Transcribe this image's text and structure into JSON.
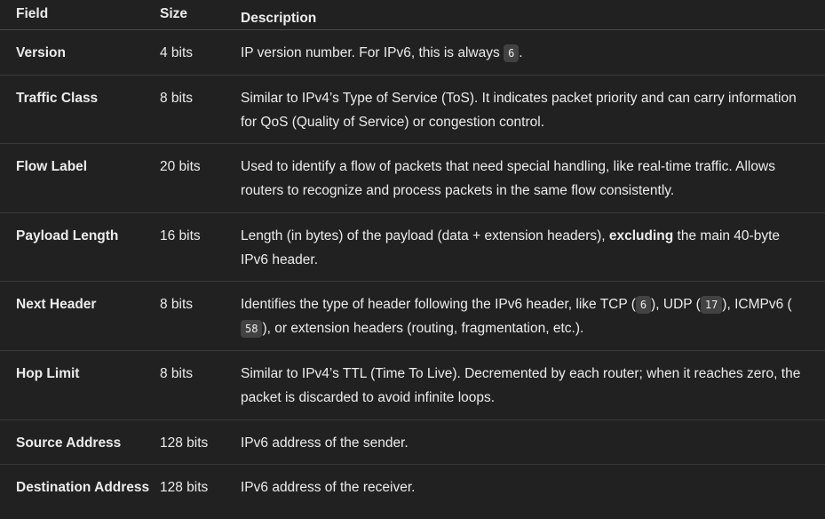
{
  "columns": [
    "Field",
    "Size",
    "Description"
  ],
  "rows": [
    {
      "field": "Version",
      "size": "4 bits",
      "desc": [
        {
          "t": "IP version number. For IPv6, this is always "
        },
        {
          "code": "6"
        },
        {
          "t": "."
        }
      ]
    },
    {
      "field": "Traffic Class",
      "size": "8 bits",
      "desc": [
        {
          "t": "Similar to IPv4’s Type of Service (ToS). It indicates packet priority and can carry information for QoS (Quality of Service) or congestion control."
        }
      ]
    },
    {
      "field": "Flow Label",
      "size": "20 bits",
      "desc": [
        {
          "t": "Used to identify a flow of packets that need special handling, like real-time traffic. Allows routers to recognize and process packets in the same flow consistently."
        }
      ]
    },
    {
      "field": "Payload Length",
      "size": "16 bits",
      "desc": [
        {
          "t": "Length (in bytes) of the payload (data + extension headers), "
        },
        {
          "b": "excluding"
        },
        {
          "t": " the main 40-byte IPv6 header."
        }
      ]
    },
    {
      "field": "Next Header",
      "size": "8 bits",
      "desc": [
        {
          "t": "Identifies the type of header following the IPv6 header, like TCP ("
        },
        {
          "code": "6"
        },
        {
          "t": "), UDP ("
        },
        {
          "code": "17"
        },
        {
          "t": "), ICMPv6 ("
        },
        {
          "code": "58"
        },
        {
          "t": "), or extension headers (routing, fragmentation, etc.)."
        }
      ]
    },
    {
      "field": "Hop Limit",
      "size": "8 bits",
      "desc": [
        {
          "t": "Similar to IPv4’s TTL (Time To Live). Decremented by each router; when it reaches zero, the packet is discarded to avoid infinite loops."
        }
      ]
    },
    {
      "field": "Source Address",
      "size": "128 bits",
      "desc": [
        {
          "t": "IPv6 address of the sender."
        }
      ]
    },
    {
      "field": "Destination Address",
      "size": "128 bits",
      "desc": [
        {
          "t": "IPv6 address of the receiver."
        }
      ]
    }
  ]
}
